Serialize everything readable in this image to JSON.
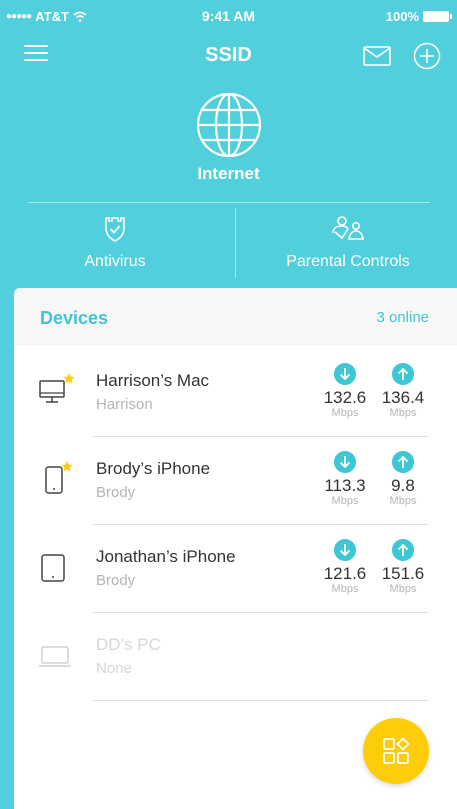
{
  "status_bar": {
    "carrier": "AT&T",
    "time": "9:41 AM",
    "battery": "100%"
  },
  "nav": {
    "title": "SSID"
  },
  "internet": {
    "label": "Internet"
  },
  "features": [
    {
      "label": "Antivirus",
      "icon": "shield-check-icon"
    },
    {
      "label": "Parental Controls",
      "icon": "family-icon"
    }
  ],
  "devices": {
    "title": "Devices",
    "online": "3 online",
    "items": [
      {
        "name": "Harrison’s Mac",
        "owner": "Harrison",
        "icon": "desktop-icon",
        "starred": true,
        "download": "132.6",
        "upload": "136.4",
        "unit": "Mbps",
        "online": true
      },
      {
        "name": "Brody’s iPhone",
        "owner": "Brody",
        "icon": "phone-icon",
        "starred": true,
        "download": "113.3",
        "upload": "9.8",
        "unit": "Mbps",
        "online": true
      },
      {
        "name": "Jonathan’s iPhone",
        "owner": "Brody",
        "icon": "tablet-icon",
        "starred": false,
        "download": "121.6",
        "upload": "151.6",
        "unit": "Mbps",
        "online": true
      },
      {
        "name": "DD’s PC",
        "owner": "None",
        "icon": "laptop-icon",
        "starred": false,
        "online": false
      }
    ]
  },
  "colors": {
    "accent": "#52cfdd",
    "fab": "#ffcc0a",
    "star": "#ffcc0a"
  },
  "fab": {
    "icon": "apps-grid-icon"
  }
}
